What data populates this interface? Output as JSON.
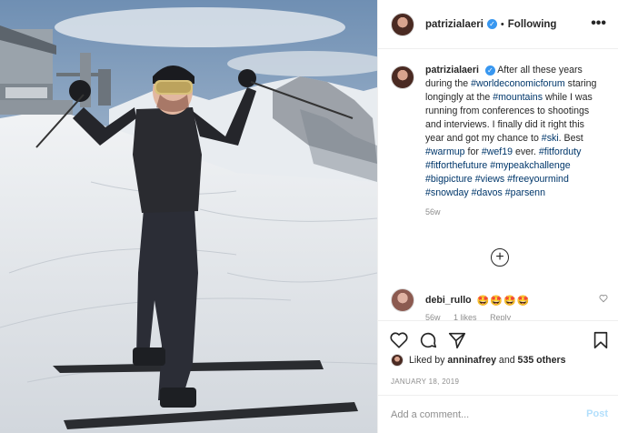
{
  "post": {
    "username": "patrizialaeri",
    "follow_status": "Following",
    "more_icon": "more-dots-icon",
    "photo_alt": "Skier on a snowy mountain top"
  },
  "caption": {
    "username": "patrizialaeri",
    "segments": [
      {
        "text": "After all these years during the ",
        "tag": false
      },
      {
        "text": "#worldeconomicforum",
        "tag": true
      },
      {
        "text": " staring longingly at the ",
        "tag": false
      },
      {
        "text": "#mountains",
        "tag": true
      },
      {
        "text": " while I was running from conferences to shootings and interviews. I finally did it right this year and got my chance to ",
        "tag": false
      },
      {
        "text": "#ski",
        "tag": true
      },
      {
        "text": ". Best ",
        "tag": false
      },
      {
        "text": "#warmup",
        "tag": true
      },
      {
        "text": " for ",
        "tag": false
      },
      {
        "text": "#wef19",
        "tag": true
      },
      {
        "text": " ever. ",
        "tag": false
      },
      {
        "text": "#fitforduty",
        "tag": true
      },
      {
        "text": " ",
        "tag": false
      },
      {
        "text": "#fitforthefuture",
        "tag": true
      },
      {
        "text": " ",
        "tag": false
      },
      {
        "text": "#mypeakchallenge",
        "tag": true
      },
      {
        "text": " ",
        "tag": false
      },
      {
        "text": "#bigpicture",
        "tag": true
      },
      {
        "text": " ",
        "tag": false
      },
      {
        "text": "#views",
        "tag": true
      },
      {
        "text": " ",
        "tag": false
      },
      {
        "text": "#freeyourmind",
        "tag": true
      },
      {
        "text": " ",
        "tag": false
      },
      {
        "text": "#snowday",
        "tag": true
      },
      {
        "text": " ",
        "tag": false
      },
      {
        "text": "#davos",
        "tag": true
      },
      {
        "text": " ",
        "tag": false
      },
      {
        "text": "#parsenn",
        "tag": true
      }
    ],
    "time_ago": "56w"
  },
  "load_more_label": "+",
  "comment": {
    "username": "debi_rullo",
    "text": "🤩🤩🤩🤩",
    "meta": [
      "56w",
      "1 likes",
      "Reply"
    ]
  },
  "likes": {
    "prefix": "Liked by ",
    "user": "anninafrey",
    "middle": " and ",
    "others": "535 others"
  },
  "date": "JANUARY 18, 2019",
  "add_comment": {
    "placeholder": "Add a comment...",
    "post_label": "Post"
  },
  "colors": {
    "link": "#00376b",
    "verified": "#3897f0",
    "post_disabled": "#b2dffc",
    "muted": "#8e8e8e"
  }
}
